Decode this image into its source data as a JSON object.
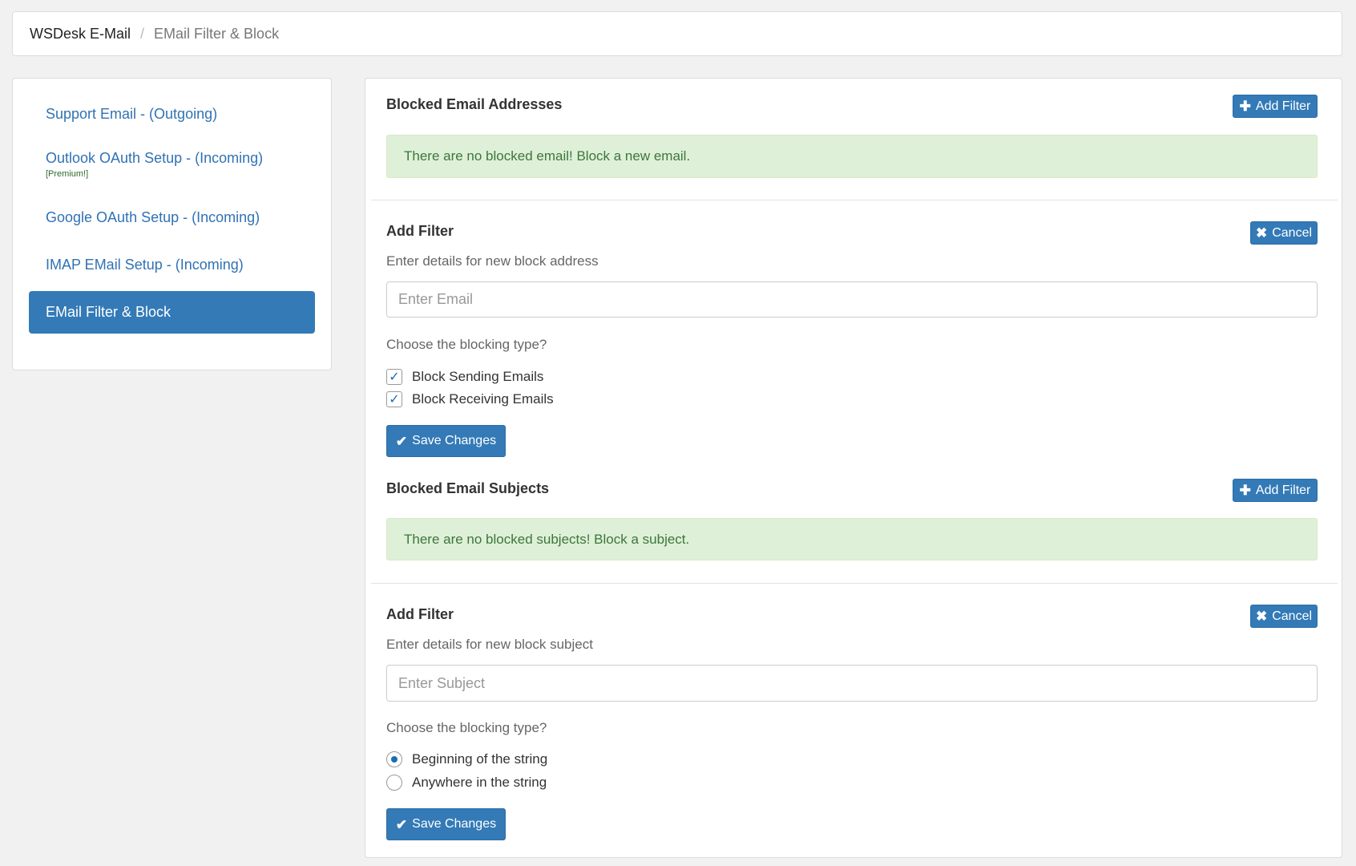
{
  "breadcrumb": {
    "root": "WSDesk E-Mail",
    "separator": "/",
    "current": "EMail Filter & Block"
  },
  "sidebar": {
    "items": [
      {
        "label": "Support Email - (Outgoing)"
      },
      {
        "label": "Outlook OAuth Setup - (Incoming)",
        "sub": "[Premium!]"
      },
      {
        "label": "Google OAuth Setup - (Incoming)"
      },
      {
        "label": "IMAP EMail Setup - (Incoming)"
      },
      {
        "label": "EMail Filter & Block",
        "active": true
      }
    ]
  },
  "blocked_emails": {
    "title": "Blocked Email Addresses",
    "add_button": "Add Filter",
    "empty_message": "There are no blocked email! Block a new email."
  },
  "email_filter_form": {
    "title": "Add Filter",
    "cancel_button": "Cancel",
    "description": "Enter details for new block address",
    "email_input": {
      "value": "",
      "placeholder": "Enter Email"
    },
    "type_question": "Choose the blocking type?",
    "options": [
      {
        "label": "Block Sending Emails",
        "checked": true
      },
      {
        "label": "Block Receiving Emails",
        "checked": true
      }
    ],
    "save_button": "Save Changes"
  },
  "blocked_subjects": {
    "title": "Blocked Email Subjects",
    "add_button": "Add Filter",
    "empty_message": "There are no blocked subjects! Block a subject."
  },
  "subject_filter_form": {
    "title": "Add Filter",
    "cancel_button": "Cancel",
    "description": "Enter details for new block subject",
    "subject_input": {
      "value": "",
      "placeholder": "Enter Subject"
    },
    "type_question": "Choose the blocking type?",
    "options": [
      {
        "label": "Beginning of the string",
        "selected": true
      },
      {
        "label": "Anywhere in the string",
        "selected": false
      }
    ],
    "save_button": "Save Changes"
  },
  "colors": {
    "primary": "#337ab7",
    "link": "#3072b3",
    "success_bg": "#dff0d8",
    "success_text": "#3c763d"
  },
  "icons": {
    "add": "plus-icon",
    "cancel": "close-icon",
    "save": "check-icon"
  }
}
